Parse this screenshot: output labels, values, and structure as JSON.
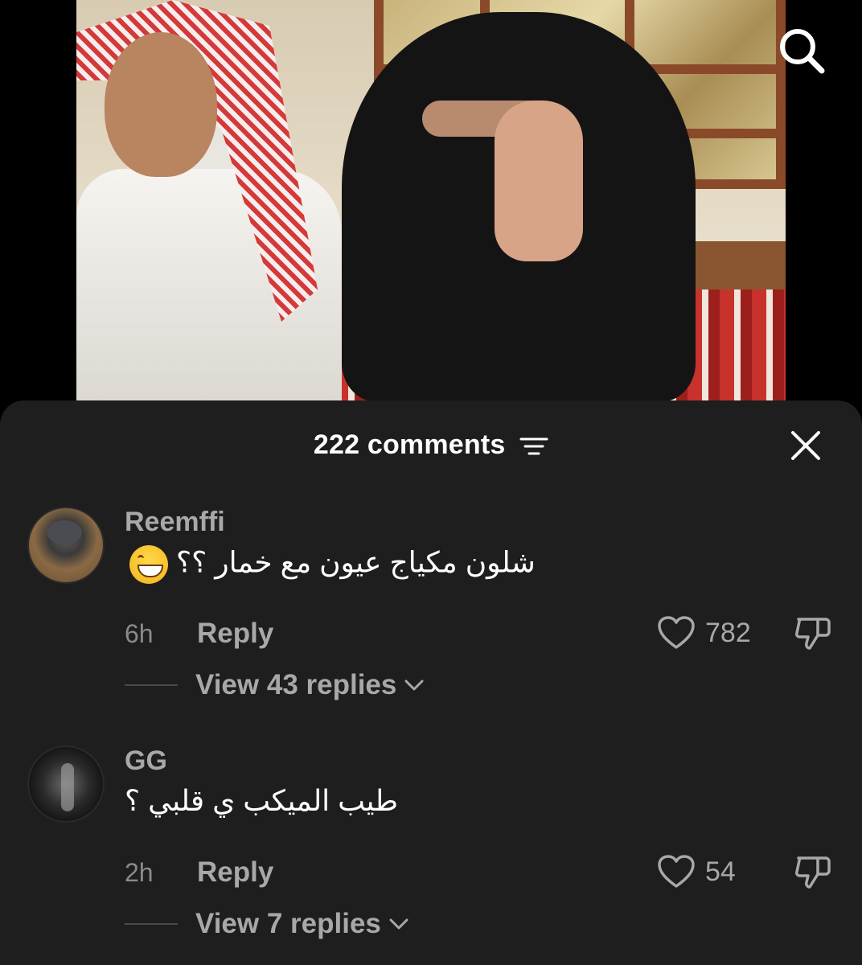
{
  "video": {
    "search_icon": "search-icon"
  },
  "sheet": {
    "title": "222 comments",
    "filter_icon": "filter-icon",
    "close_icon": "close-icon"
  },
  "comments": [
    {
      "username": "Reemffi",
      "text": "شلون مكياج عيون مع خمار ؟؟",
      "emoji": "grinning-face",
      "time": "6h",
      "reply_label": "Reply",
      "likes": "782",
      "view_replies": "View 43 replies"
    },
    {
      "username": "GG",
      "text": "طيب الميكب ي قلبي ؟",
      "time": "2h",
      "reply_label": "Reply",
      "likes": "54",
      "view_replies": "View 7 replies"
    }
  ],
  "colors": {
    "sheet_bg": "#1e1e1e",
    "text_primary": "#ffffff",
    "text_secondary": "#a8a8a8",
    "text_muted": "#8a8a8a"
  }
}
